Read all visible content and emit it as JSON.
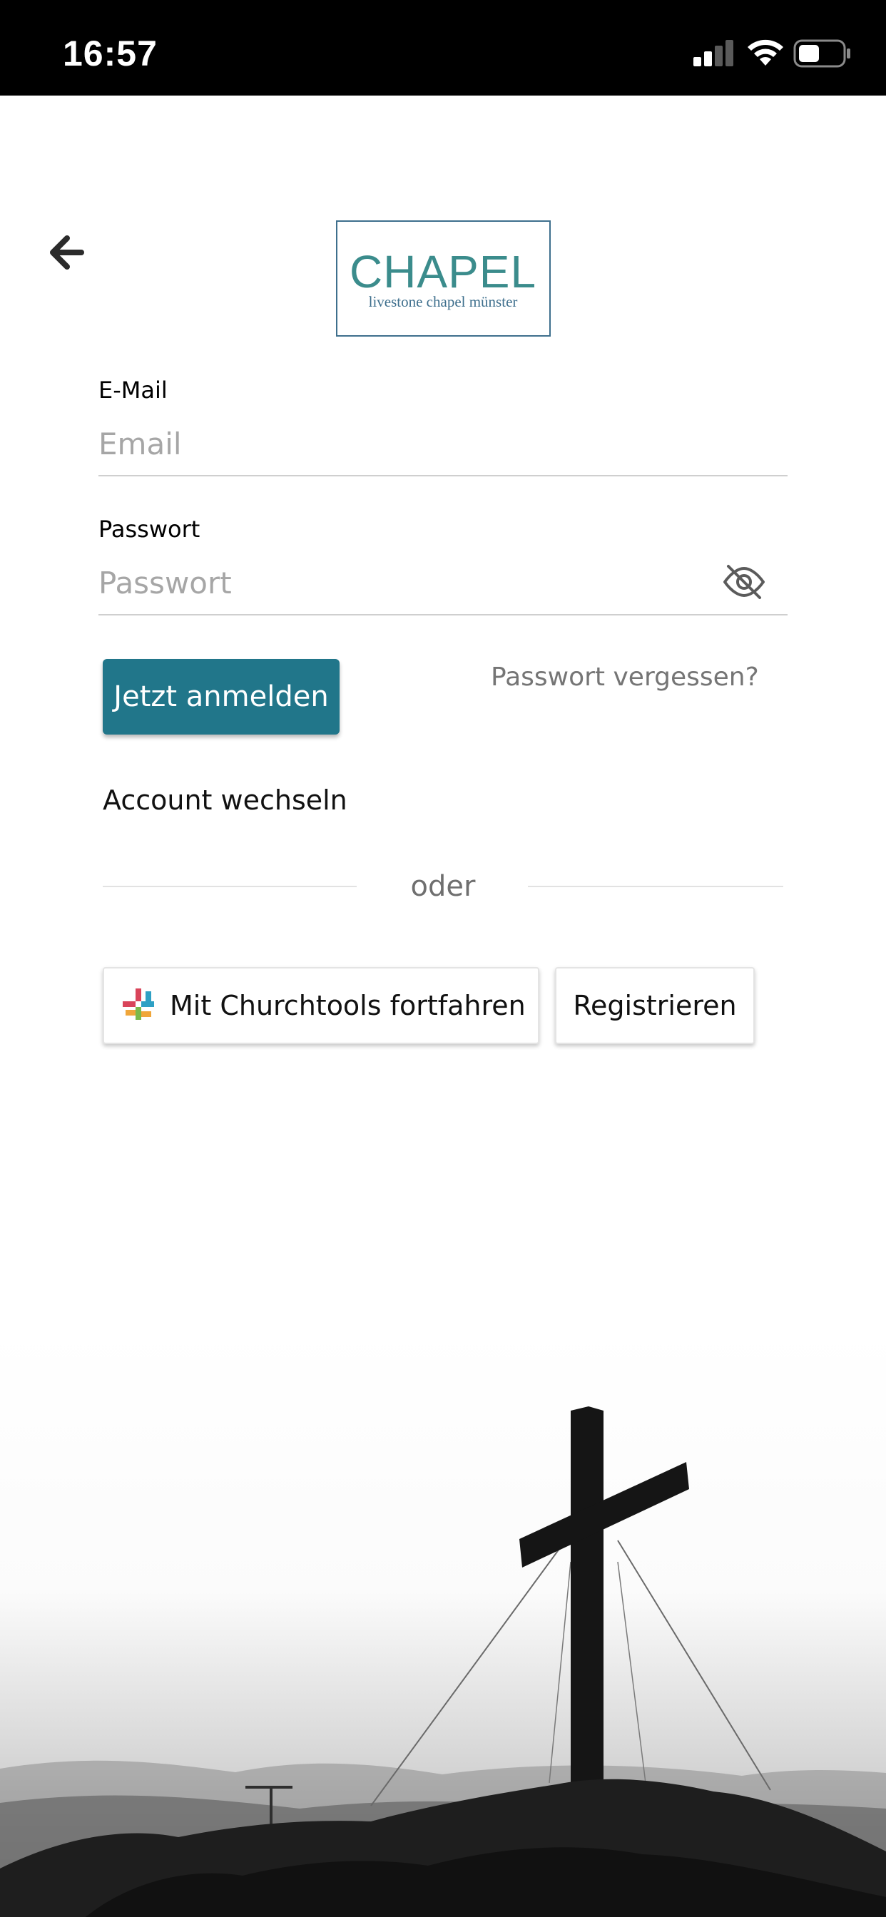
{
  "status_bar": {
    "time": "16:57"
  },
  "logo": {
    "brand": "CHAPEL",
    "tagline": "livestone chapel münster",
    "colors": {
      "teal": "#3b8c8c",
      "blue": "#3e6f8d"
    }
  },
  "login_form": {
    "email": {
      "label": "E-Mail",
      "placeholder": "Email",
      "value": ""
    },
    "password": {
      "label": "Passwort",
      "placeholder": "Passwort",
      "value": ""
    },
    "login_button": "Jetzt anmelden",
    "forgot_password": "Passwort vergessen?",
    "switch_account": "Account wechseln"
  },
  "divider": {
    "text": "oder"
  },
  "alternatives": {
    "churchtools_button": "Mit Churchtools fortfahren",
    "register_button": "Registrieren"
  },
  "icons": {
    "back": "arrow-left-icon",
    "password_visibility": "eye-slash-icon",
    "churchtools": "churchtools-logo-icon",
    "signal": "cellular-signal-icon",
    "wifi": "wifi-icon",
    "battery": "battery-icon"
  },
  "colors": {
    "primary": "#21768a",
    "status_bar": "#000000",
    "placeholder": "#a6a6a6",
    "secondary_text": "#757575"
  }
}
